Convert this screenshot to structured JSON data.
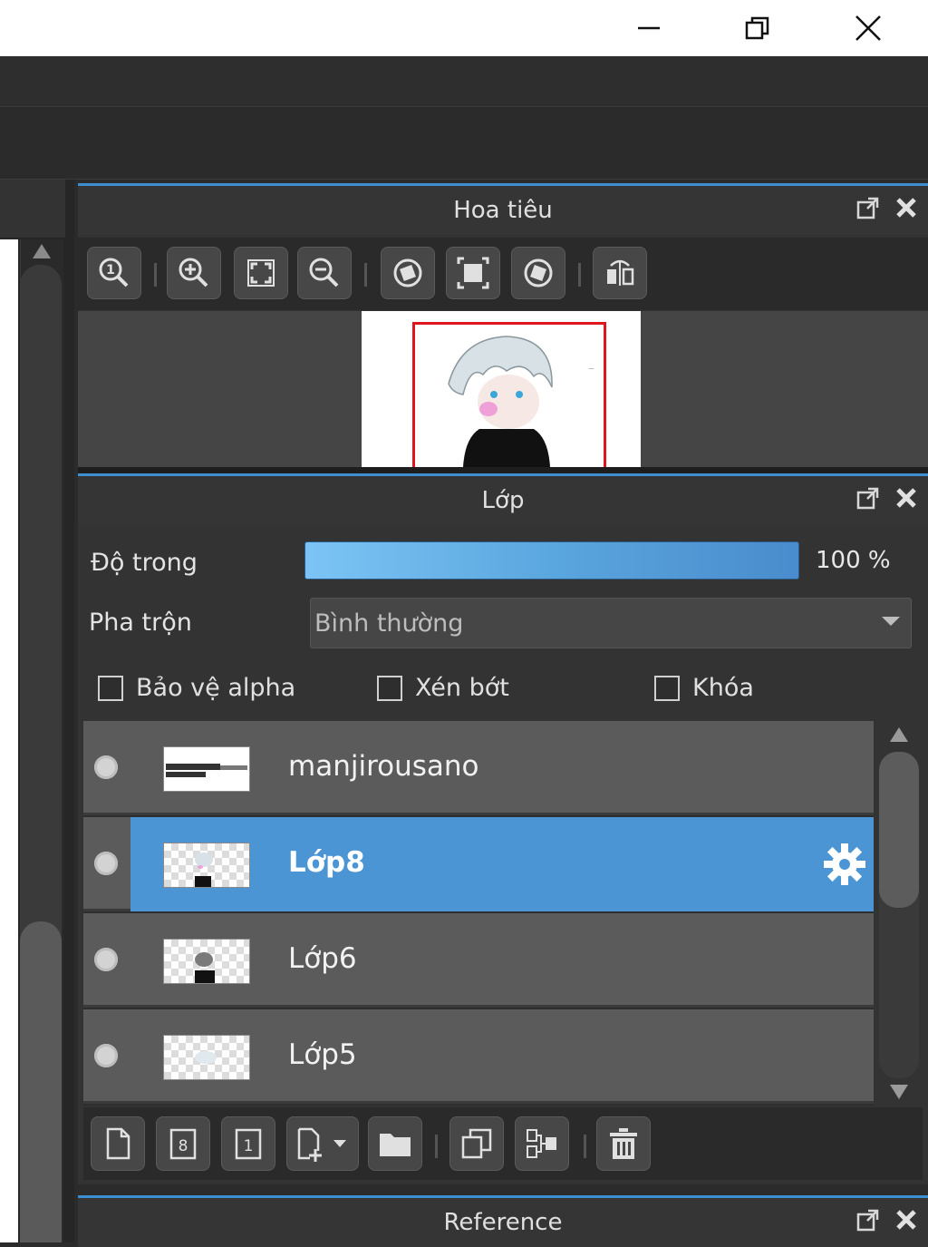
{
  "window": {
    "minimize_label": "Minimize",
    "maximize_label": "Restore",
    "close_label": "Close"
  },
  "navigator": {
    "title": "Hoa tiêu",
    "toolbar_icons": [
      "zoom-actual-icon",
      "zoom-in-icon",
      "fit-screen-icon",
      "zoom-out-icon",
      "rotate-left-icon",
      "fit-window-icon",
      "rotate-right-icon",
      "flip-icon"
    ]
  },
  "layers": {
    "title": "Lớp",
    "opacity_label": "Độ trong",
    "opacity_value": "100 %",
    "opacity_fraction": 1.0,
    "blend_label": "Pha trộn",
    "blend_value": "Bình thường",
    "checkboxes": {
      "protect_alpha": "Bảo vệ alpha",
      "clipping": "Xén bớt",
      "lock": "Khóa"
    },
    "items": [
      {
        "name": "manjirousano",
        "selected": false
      },
      {
        "name": "Lớp8",
        "selected": true
      },
      {
        "name": "Lớp6",
        "selected": false
      },
      {
        "name": "Lớp5",
        "selected": false
      }
    ],
    "toolbar_icons": [
      "new-layer-icon",
      "new-8bit-layer-icon",
      "new-1bit-layer-icon",
      "add-layer-menu-icon",
      "new-folder-icon",
      "duplicate-layer-icon",
      "merge-layer-icon",
      "delete-layer-icon"
    ]
  },
  "reference": {
    "title": "Reference"
  },
  "colors": {
    "accent": "#3d8fd1",
    "selected_row": "#4b95d4",
    "panel_bg": "#333333"
  }
}
